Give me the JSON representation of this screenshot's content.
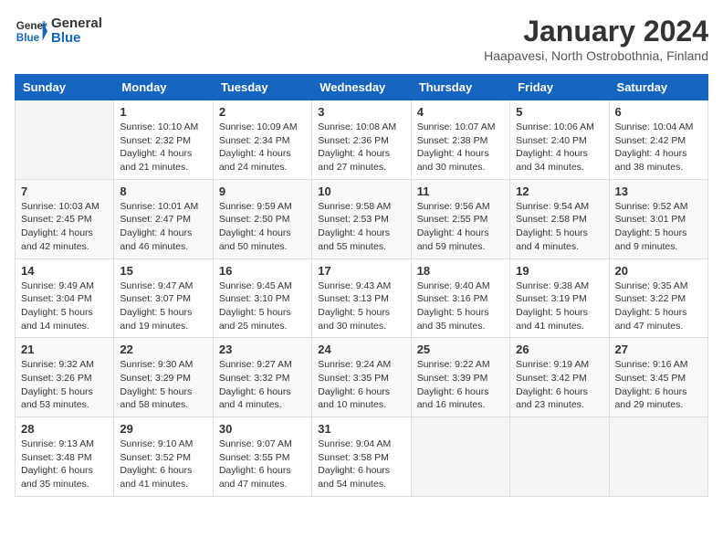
{
  "header": {
    "logo_general": "General",
    "logo_blue": "Blue",
    "month": "January 2024",
    "location": "Haapavesi, North Ostrobothnia, Finland"
  },
  "days_of_week": [
    "Sunday",
    "Monday",
    "Tuesday",
    "Wednesday",
    "Thursday",
    "Friday",
    "Saturday"
  ],
  "weeks": [
    [
      {
        "day": "",
        "info": ""
      },
      {
        "day": "1",
        "info": "Sunrise: 10:10 AM\nSunset: 2:32 PM\nDaylight: 4 hours\nand 21 minutes."
      },
      {
        "day": "2",
        "info": "Sunrise: 10:09 AM\nSunset: 2:34 PM\nDaylight: 4 hours\nand 24 minutes."
      },
      {
        "day": "3",
        "info": "Sunrise: 10:08 AM\nSunset: 2:36 PM\nDaylight: 4 hours\nand 27 minutes."
      },
      {
        "day": "4",
        "info": "Sunrise: 10:07 AM\nSunset: 2:38 PM\nDaylight: 4 hours\nand 30 minutes."
      },
      {
        "day": "5",
        "info": "Sunrise: 10:06 AM\nSunset: 2:40 PM\nDaylight: 4 hours\nand 34 minutes."
      },
      {
        "day": "6",
        "info": "Sunrise: 10:04 AM\nSunset: 2:42 PM\nDaylight: 4 hours\nand 38 minutes."
      }
    ],
    [
      {
        "day": "7",
        "info": "Sunrise: 10:03 AM\nSunset: 2:45 PM\nDaylight: 4 hours\nand 42 minutes."
      },
      {
        "day": "8",
        "info": "Sunrise: 10:01 AM\nSunset: 2:47 PM\nDaylight: 4 hours\nand 46 minutes."
      },
      {
        "day": "9",
        "info": "Sunrise: 9:59 AM\nSunset: 2:50 PM\nDaylight: 4 hours\nand 50 minutes."
      },
      {
        "day": "10",
        "info": "Sunrise: 9:58 AM\nSunset: 2:53 PM\nDaylight: 4 hours\nand 55 minutes."
      },
      {
        "day": "11",
        "info": "Sunrise: 9:56 AM\nSunset: 2:55 PM\nDaylight: 4 hours\nand 59 minutes."
      },
      {
        "day": "12",
        "info": "Sunrise: 9:54 AM\nSunset: 2:58 PM\nDaylight: 5 hours\nand 4 minutes."
      },
      {
        "day": "13",
        "info": "Sunrise: 9:52 AM\nSunset: 3:01 PM\nDaylight: 5 hours\nand 9 minutes."
      }
    ],
    [
      {
        "day": "14",
        "info": "Sunrise: 9:49 AM\nSunset: 3:04 PM\nDaylight: 5 hours\nand 14 minutes."
      },
      {
        "day": "15",
        "info": "Sunrise: 9:47 AM\nSunset: 3:07 PM\nDaylight: 5 hours\nand 19 minutes."
      },
      {
        "day": "16",
        "info": "Sunrise: 9:45 AM\nSunset: 3:10 PM\nDaylight: 5 hours\nand 25 minutes."
      },
      {
        "day": "17",
        "info": "Sunrise: 9:43 AM\nSunset: 3:13 PM\nDaylight: 5 hours\nand 30 minutes."
      },
      {
        "day": "18",
        "info": "Sunrise: 9:40 AM\nSunset: 3:16 PM\nDaylight: 5 hours\nand 35 minutes."
      },
      {
        "day": "19",
        "info": "Sunrise: 9:38 AM\nSunset: 3:19 PM\nDaylight: 5 hours\nand 41 minutes."
      },
      {
        "day": "20",
        "info": "Sunrise: 9:35 AM\nSunset: 3:22 PM\nDaylight: 5 hours\nand 47 minutes."
      }
    ],
    [
      {
        "day": "21",
        "info": "Sunrise: 9:32 AM\nSunset: 3:26 PM\nDaylight: 5 hours\nand 53 minutes."
      },
      {
        "day": "22",
        "info": "Sunrise: 9:30 AM\nSunset: 3:29 PM\nDaylight: 5 hours\nand 58 minutes."
      },
      {
        "day": "23",
        "info": "Sunrise: 9:27 AM\nSunset: 3:32 PM\nDaylight: 6 hours\nand 4 minutes."
      },
      {
        "day": "24",
        "info": "Sunrise: 9:24 AM\nSunset: 3:35 PM\nDaylight: 6 hours\nand 10 minutes."
      },
      {
        "day": "25",
        "info": "Sunrise: 9:22 AM\nSunset: 3:39 PM\nDaylight: 6 hours\nand 16 minutes."
      },
      {
        "day": "26",
        "info": "Sunrise: 9:19 AM\nSunset: 3:42 PM\nDaylight: 6 hours\nand 23 minutes."
      },
      {
        "day": "27",
        "info": "Sunrise: 9:16 AM\nSunset: 3:45 PM\nDaylight: 6 hours\nand 29 minutes."
      }
    ],
    [
      {
        "day": "28",
        "info": "Sunrise: 9:13 AM\nSunset: 3:48 PM\nDaylight: 6 hours\nand 35 minutes."
      },
      {
        "day": "29",
        "info": "Sunrise: 9:10 AM\nSunset: 3:52 PM\nDaylight: 6 hours\nand 41 minutes."
      },
      {
        "day": "30",
        "info": "Sunrise: 9:07 AM\nSunset: 3:55 PM\nDaylight: 6 hours\nand 47 minutes."
      },
      {
        "day": "31",
        "info": "Sunrise: 9:04 AM\nSunset: 3:58 PM\nDaylight: 6 hours\nand 54 minutes."
      },
      {
        "day": "",
        "info": ""
      },
      {
        "day": "",
        "info": ""
      },
      {
        "day": "",
        "info": ""
      }
    ]
  ]
}
